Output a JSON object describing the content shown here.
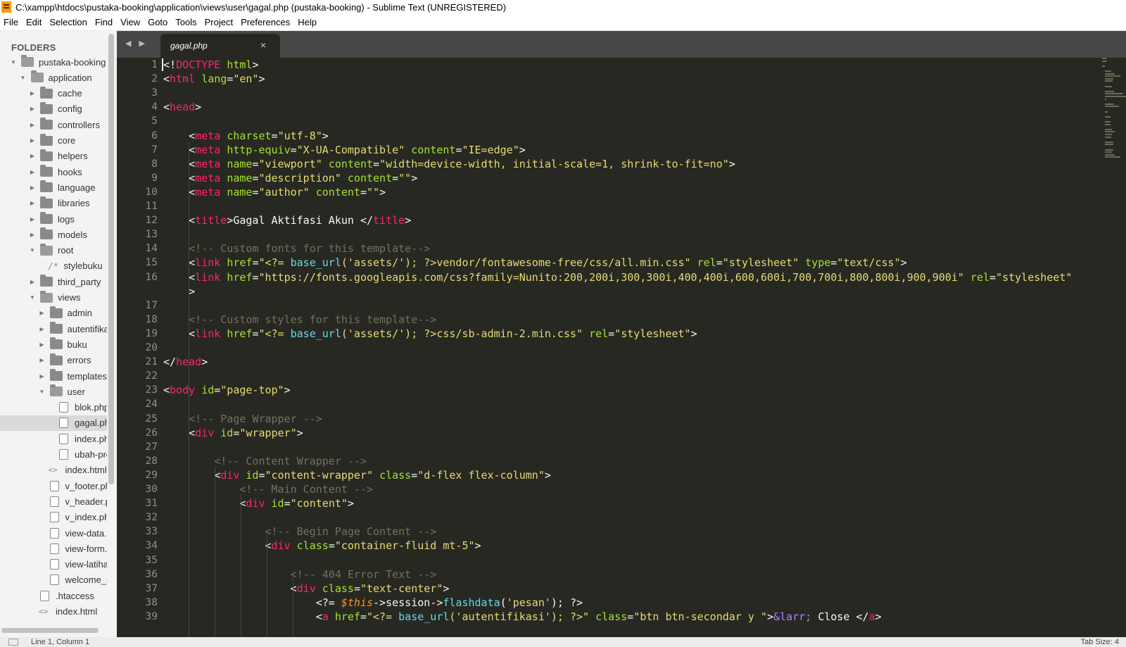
{
  "window": {
    "title": "C:\\xampp\\htdocs\\pustaka-booking\\application\\views\\user\\gagal.php (pustaka-booking) - Sublime Text (UNREGISTERED)"
  },
  "menu": [
    "File",
    "Edit",
    "Selection",
    "Find",
    "View",
    "Goto",
    "Tools",
    "Project",
    "Preferences",
    "Help"
  ],
  "sidebar": {
    "header": "FOLDERS",
    "tree": [
      {
        "label": "pustaka-booking",
        "type": "folder",
        "open": true,
        "depth": 0
      },
      {
        "label": "application",
        "type": "folder",
        "open": true,
        "depth": 1
      },
      {
        "label": "cache",
        "type": "folder",
        "open": false,
        "depth": 2
      },
      {
        "label": "config",
        "type": "folder",
        "open": false,
        "depth": 2
      },
      {
        "label": "controllers",
        "type": "folder",
        "open": false,
        "depth": 2
      },
      {
        "label": "core",
        "type": "folder",
        "open": false,
        "depth": 2
      },
      {
        "label": "helpers",
        "type": "folder",
        "open": false,
        "depth": 2
      },
      {
        "label": "hooks",
        "type": "folder",
        "open": false,
        "depth": 2
      },
      {
        "label": "language",
        "type": "folder",
        "open": false,
        "depth": 2
      },
      {
        "label": "libraries",
        "type": "folder",
        "open": false,
        "depth": 2
      },
      {
        "label": "logs",
        "type": "folder",
        "open": false,
        "depth": 2
      },
      {
        "label": "models",
        "type": "folder",
        "open": false,
        "depth": 2
      },
      {
        "label": "root",
        "type": "folder",
        "open": true,
        "depth": 2
      },
      {
        "label": "stylebuku",
        "type": "link",
        "depth": 3
      },
      {
        "label": "third_party",
        "type": "folder",
        "open": false,
        "depth": 2
      },
      {
        "label": "views",
        "type": "folder",
        "open": true,
        "depth": 2
      },
      {
        "label": "admin",
        "type": "folder",
        "open": false,
        "depth": 3
      },
      {
        "label": "autentifikasi",
        "type": "folder",
        "open": false,
        "depth": 3
      },
      {
        "label": "buku",
        "type": "folder",
        "open": false,
        "depth": 3
      },
      {
        "label": "errors",
        "type": "folder",
        "open": false,
        "depth": 3
      },
      {
        "label": "templates",
        "type": "folder",
        "open": false,
        "depth": 3
      },
      {
        "label": "user",
        "type": "folder",
        "open": true,
        "depth": 3
      },
      {
        "label": "blok.php",
        "type": "file",
        "depth": 4
      },
      {
        "label": "gagal.php",
        "type": "file",
        "depth": 4,
        "selected": true
      },
      {
        "label": "index.php",
        "type": "file",
        "depth": 4
      },
      {
        "label": "ubah-profile.php",
        "type": "file",
        "depth": 4
      },
      {
        "label": "index.html",
        "type": "html",
        "depth": 3
      },
      {
        "label": "v_footer.php",
        "type": "file",
        "depth": 3
      },
      {
        "label": "v_header.php",
        "type": "file",
        "depth": 3
      },
      {
        "label": "v_index.php",
        "type": "file",
        "depth": 3
      },
      {
        "label": "view-data.php",
        "type": "file",
        "depth": 3
      },
      {
        "label": "view-form.php",
        "type": "file",
        "depth": 3
      },
      {
        "label": "view-latihan.php",
        "type": "file",
        "depth": 3
      },
      {
        "label": "welcome_message.php",
        "type": "file",
        "depth": 3
      },
      {
        "label": ".htaccess",
        "type": "file",
        "depth": 2
      },
      {
        "label": "index.html",
        "type": "html",
        "depth": 2
      }
    ]
  },
  "tabs": {
    "nav": "◀ ▶",
    "active": {
      "label": "gagal.php",
      "close": "×"
    }
  },
  "code": {
    "lines": [
      {
        "n": "1",
        "tokens": [
          [
            "p",
            "<!"
          ],
          [
            "tag",
            "DOCTYPE"
          ],
          [
            "p",
            " "
          ],
          [
            "attr",
            "html"
          ],
          [
            "p",
            ">"
          ]
        ]
      },
      {
        "n": "2",
        "tokens": [
          [
            "p",
            "<"
          ],
          [
            "tag",
            "html"
          ],
          [
            "p",
            " "
          ],
          [
            "attr",
            "lang"
          ],
          [
            "p",
            "="
          ],
          [
            "str",
            "\"en\""
          ],
          [
            "p",
            ">"
          ]
        ]
      },
      {
        "n": "3",
        "tokens": []
      },
      {
        "n": "4",
        "tokens": [
          [
            "p",
            "<"
          ],
          [
            "tag",
            "head"
          ],
          [
            "p",
            ">"
          ]
        ]
      },
      {
        "n": "5",
        "tokens": []
      },
      {
        "n": "6",
        "tokens": [
          [
            "p",
            "    <"
          ],
          [
            "tag",
            "meta"
          ],
          [
            "p",
            " "
          ],
          [
            "attr",
            "charset"
          ],
          [
            "p",
            "="
          ],
          [
            "str",
            "\"utf-8\""
          ],
          [
            "p",
            ">"
          ]
        ]
      },
      {
        "n": "7",
        "tokens": [
          [
            "p",
            "    <"
          ],
          [
            "tag",
            "meta"
          ],
          [
            "p",
            " "
          ],
          [
            "attr",
            "http-equiv"
          ],
          [
            "p",
            "="
          ],
          [
            "str",
            "\"X-UA-Compatible\""
          ],
          [
            "p",
            " "
          ],
          [
            "attr",
            "content"
          ],
          [
            "p",
            "="
          ],
          [
            "str",
            "\"IE=edge\""
          ],
          [
            "p",
            ">"
          ]
        ]
      },
      {
        "n": "8",
        "tokens": [
          [
            "p",
            "    <"
          ],
          [
            "tag",
            "meta"
          ],
          [
            "p",
            " "
          ],
          [
            "attr",
            "name"
          ],
          [
            "p",
            "="
          ],
          [
            "str",
            "\"viewport\""
          ],
          [
            "p",
            " "
          ],
          [
            "attr",
            "content"
          ],
          [
            "p",
            "="
          ],
          [
            "str",
            "\"width=device-width, initial-scale=1, shrink-to-fit=no\""
          ],
          [
            "p",
            ">"
          ]
        ]
      },
      {
        "n": "9",
        "tokens": [
          [
            "p",
            "    <"
          ],
          [
            "tag",
            "meta"
          ],
          [
            "p",
            " "
          ],
          [
            "attr",
            "name"
          ],
          [
            "p",
            "="
          ],
          [
            "str",
            "\"description\""
          ],
          [
            "p",
            " "
          ],
          [
            "attr",
            "content"
          ],
          [
            "p",
            "="
          ],
          [
            "str",
            "\"\""
          ],
          [
            "p",
            ">"
          ]
        ]
      },
      {
        "n": "10",
        "tokens": [
          [
            "p",
            "    <"
          ],
          [
            "tag",
            "meta"
          ],
          [
            "p",
            " "
          ],
          [
            "attr",
            "name"
          ],
          [
            "p",
            "="
          ],
          [
            "str",
            "\"author\""
          ],
          [
            "p",
            " "
          ],
          [
            "attr",
            "content"
          ],
          [
            "p",
            "="
          ],
          [
            "str",
            "\"\""
          ],
          [
            "p",
            ">"
          ]
        ]
      },
      {
        "n": "11",
        "tokens": []
      },
      {
        "n": "12",
        "tokens": [
          [
            "p",
            "    <"
          ],
          [
            "tag",
            "title"
          ],
          [
            "p",
            ">Gagal Aktifasi Akun </"
          ],
          [
            "tag",
            "title"
          ],
          [
            "p",
            ">"
          ]
        ]
      },
      {
        "n": "13",
        "tokens": []
      },
      {
        "n": "14",
        "tokens": [
          [
            "com",
            "    <!-- Custom fonts for this template-->"
          ]
        ]
      },
      {
        "n": "15",
        "tokens": [
          [
            "p",
            "    <"
          ],
          [
            "tag",
            "link"
          ],
          [
            "p",
            " "
          ],
          [
            "attr",
            "href"
          ],
          [
            "p",
            "="
          ],
          [
            "str",
            "\"<?= "
          ],
          [
            "fn",
            "base_url"
          ],
          [
            "str",
            "('assets/'); ?>vendor/fontawesome-free/css/all.min.css\""
          ],
          [
            "p",
            " "
          ],
          [
            "attr",
            "rel"
          ],
          [
            "p",
            "="
          ],
          [
            "str",
            "\"stylesheet\""
          ],
          [
            "p",
            " "
          ],
          [
            "attr",
            "type"
          ],
          [
            "p",
            "="
          ],
          [
            "str",
            "\"text/css\""
          ],
          [
            "p",
            ">"
          ]
        ]
      },
      {
        "n": "16",
        "tokens": [
          [
            "p",
            "    <"
          ],
          [
            "tag",
            "link"
          ],
          [
            "p",
            " "
          ],
          [
            "attr",
            "href"
          ],
          [
            "p",
            "="
          ],
          [
            "str",
            "\"https://fonts.googleapis.com/css?family=Nunito:200,200i,300,300i,400,400i,600,600i,700,700i,800,800i,900,900i\""
          ],
          [
            "p",
            " "
          ],
          [
            "attr",
            "rel"
          ],
          [
            "p",
            "="
          ],
          [
            "str",
            "\"stylesheet\""
          ]
        ]
      },
      {
        "n": "",
        "tokens": [
          [
            "p",
            "    >"
          ]
        ]
      },
      {
        "n": "17",
        "tokens": []
      },
      {
        "n": "18",
        "tokens": [
          [
            "com",
            "    <!-- Custom styles for this template-->"
          ]
        ]
      },
      {
        "n": "19",
        "tokens": [
          [
            "p",
            "    <"
          ],
          [
            "tag",
            "link"
          ],
          [
            "p",
            " "
          ],
          [
            "attr",
            "href"
          ],
          [
            "p",
            "="
          ],
          [
            "str",
            "\"<?= "
          ],
          [
            "fn",
            "base_url"
          ],
          [
            "str",
            "('assets/'); ?>css/sb-admin-2.min.css\""
          ],
          [
            "p",
            " "
          ],
          [
            "attr",
            "rel"
          ],
          [
            "p",
            "="
          ],
          [
            "str",
            "\"stylesheet\""
          ],
          [
            "p",
            ">"
          ]
        ]
      },
      {
        "n": "20",
        "tokens": []
      },
      {
        "n": "21",
        "tokens": [
          [
            "p",
            "</"
          ],
          [
            "tag",
            "head"
          ],
          [
            "p",
            ">"
          ]
        ]
      },
      {
        "n": "22",
        "tokens": []
      },
      {
        "n": "23",
        "tokens": [
          [
            "p",
            "<"
          ],
          [
            "tag",
            "body"
          ],
          [
            "p",
            " "
          ],
          [
            "attr",
            "id"
          ],
          [
            "p",
            "="
          ],
          [
            "str",
            "\"page-top\""
          ],
          [
            "p",
            ">"
          ]
        ]
      },
      {
        "n": "24",
        "tokens": []
      },
      {
        "n": "25",
        "tokens": [
          [
            "com",
            "    <!-- Page Wrapper -->"
          ]
        ]
      },
      {
        "n": "26",
        "tokens": [
          [
            "p",
            "    <"
          ],
          [
            "tag",
            "div"
          ],
          [
            "p",
            " "
          ],
          [
            "attr",
            "id"
          ],
          [
            "p",
            "="
          ],
          [
            "str",
            "\"wrapper\""
          ],
          [
            "p",
            ">"
          ]
        ]
      },
      {
        "n": "27",
        "tokens": []
      },
      {
        "n": "28",
        "tokens": [
          [
            "com",
            "        <!-- Content Wrapper -->"
          ]
        ]
      },
      {
        "n": "29",
        "tokens": [
          [
            "p",
            "        <"
          ],
          [
            "tag",
            "div"
          ],
          [
            "p",
            " "
          ],
          [
            "attr",
            "id"
          ],
          [
            "p",
            "="
          ],
          [
            "str",
            "\"content-wrapper\""
          ],
          [
            "p",
            " "
          ],
          [
            "attr",
            "class"
          ],
          [
            "p",
            "="
          ],
          [
            "str",
            "\"d-flex flex-column\""
          ],
          [
            "p",
            ">"
          ]
        ]
      },
      {
        "n": "30",
        "tokens": [
          [
            "com",
            "            <!-- Main Content -->"
          ]
        ]
      },
      {
        "n": "31",
        "tokens": [
          [
            "p",
            "            <"
          ],
          [
            "tag",
            "div"
          ],
          [
            "p",
            " "
          ],
          [
            "attr",
            "id"
          ],
          [
            "p",
            "="
          ],
          [
            "str",
            "\"content\""
          ],
          [
            "p",
            ">"
          ]
        ]
      },
      {
        "n": "32",
        "tokens": []
      },
      {
        "n": "33",
        "tokens": [
          [
            "com",
            "                <!-- Begin Page Content -->"
          ]
        ]
      },
      {
        "n": "34",
        "tokens": [
          [
            "p",
            "                <"
          ],
          [
            "tag",
            "div"
          ],
          [
            "p",
            " "
          ],
          [
            "attr",
            "class"
          ],
          [
            "p",
            "="
          ],
          [
            "str",
            "\"container-fluid mt-5\""
          ],
          [
            "p",
            ">"
          ]
        ]
      },
      {
        "n": "35",
        "tokens": []
      },
      {
        "n": "36",
        "tokens": [
          [
            "com",
            "                    <!-- 404 Error Text -->"
          ]
        ]
      },
      {
        "n": "37",
        "tokens": [
          [
            "p",
            "                    <"
          ],
          [
            "tag",
            "div"
          ],
          [
            "p",
            " "
          ],
          [
            "attr",
            "class"
          ],
          [
            "p",
            "="
          ],
          [
            "str",
            "\"text-center\""
          ],
          [
            "p",
            ">"
          ]
        ]
      },
      {
        "n": "38",
        "tokens": [
          [
            "p",
            "                        <?= "
          ],
          [
            "var",
            "$this"
          ],
          [
            "p",
            "->session->"
          ],
          [
            "fn",
            "flashdata"
          ],
          [
            "p",
            "("
          ],
          [
            "str",
            "'pesan'"
          ],
          [
            "p",
            "); ?>"
          ]
        ]
      },
      {
        "n": "39",
        "tokens": [
          [
            "p",
            "                        <"
          ],
          [
            "tag",
            "a"
          ],
          [
            "p",
            " "
          ],
          [
            "attr",
            "href"
          ],
          [
            "p",
            "="
          ],
          [
            "str",
            "\"<?= "
          ],
          [
            "fn",
            "base_url"
          ],
          [
            "str",
            "('autentifikasi'); ?>\""
          ],
          [
            "p",
            " "
          ],
          [
            "attr",
            "class"
          ],
          [
            "p",
            "="
          ],
          [
            "str",
            "\"btn btn-secondar y \""
          ],
          [
            "p",
            ">"
          ],
          [
            "ent",
            "&larr;"
          ],
          [
            "p",
            " Close </"
          ],
          [
            "tag",
            "a"
          ],
          [
            "p",
            ">"
          ]
        ]
      }
    ]
  },
  "status": {
    "position": "Line 1, Column 1",
    "tab_size": "Tab Size: 4"
  },
  "colors": {
    "editor_bg": "#272822",
    "tag": "#f92672",
    "attribute": "#a6e22e",
    "string": "#e6db74",
    "comment": "#75715e",
    "function": "#66d9ef"
  }
}
